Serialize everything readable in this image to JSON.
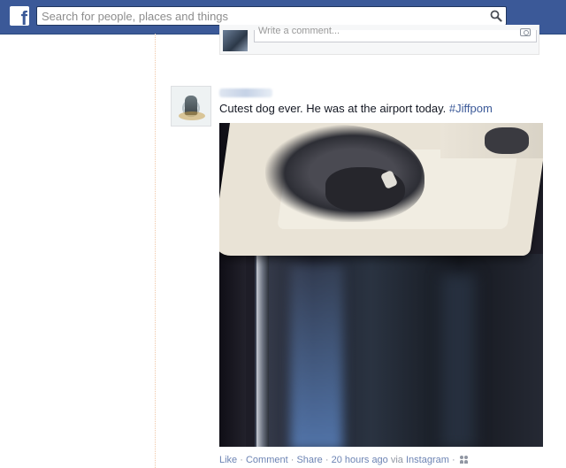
{
  "header": {
    "logo_letter": "f",
    "search_placeholder": "Search for people, places and things",
    "brand_color": "#3b5998"
  },
  "comment_box": {
    "placeholder": "Write a comment..."
  },
  "post": {
    "text": "Cutest dog ever. He was at the airport today. ",
    "hashtag": "#Jiffpom",
    "actions": {
      "like": "Like",
      "comment": "Comment",
      "share": "Share",
      "separator": " · ",
      "timestamp": "20 hours ago",
      "via_prefix": " via ",
      "source": "Instagram"
    }
  },
  "icons": {
    "logo": "facebook-logo",
    "search": "search-icon",
    "camera": "camera-icon",
    "audience": "friends-audience-icon"
  }
}
